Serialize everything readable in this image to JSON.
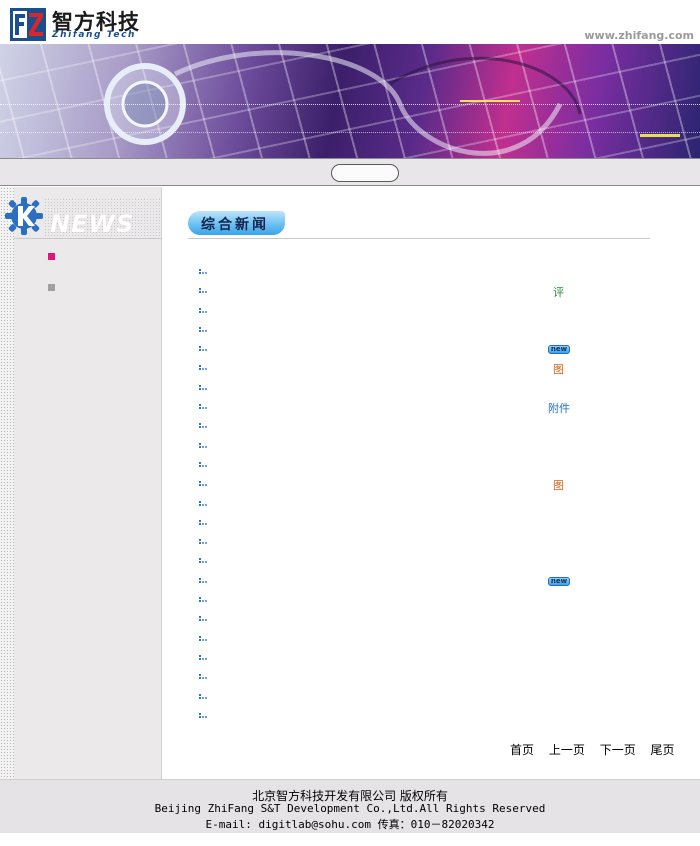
{
  "header": {
    "logo_cn": "智方科技",
    "logo_en": "Zhifang Tech",
    "site_url": "www.zhifang.com"
  },
  "sidebar": {
    "heading": "NEWS",
    "items": [
      {
        "bullet_color": "#e0157c"
      },
      {
        "bullet_color": "#a0a0a0"
      }
    ]
  },
  "main": {
    "section_title": "综合新闻",
    "news": [
      {
        "tag": ""
      },
      {
        "tag": "评"
      },
      {
        "tag": ""
      },
      {
        "tag": ""
      },
      {
        "tag": "new"
      },
      {
        "tag": "图"
      },
      {
        "tag": ""
      },
      {
        "tag": "附件"
      },
      {
        "tag": ""
      },
      {
        "tag": ""
      },
      {
        "tag": ""
      },
      {
        "tag": "图"
      },
      {
        "tag": ""
      },
      {
        "tag": ""
      },
      {
        "tag": ""
      },
      {
        "tag": ""
      },
      {
        "tag": "new"
      },
      {
        "tag": ""
      },
      {
        "tag": ""
      },
      {
        "tag": ""
      },
      {
        "tag": ""
      },
      {
        "tag": ""
      },
      {
        "tag": ""
      },
      {
        "tag": ""
      }
    ],
    "pager": {
      "first": "首页",
      "prev": "上一页",
      "next": "下一页",
      "last": "尾页"
    }
  },
  "footer": {
    "line1": "北京智方科技开发有限公司 版权所有",
    "line2": "Beijing ZhiFang S&T Development Co.,Ltd.All Rights Reserved",
    "line3": "E-mail: digitlab@sohu.com 传真：010－82020342"
  },
  "colors": {
    "accent_blue": "#3aa5e8",
    "logo_red": "#d9262b",
    "logo_blue": "#1a4e8f"
  }
}
